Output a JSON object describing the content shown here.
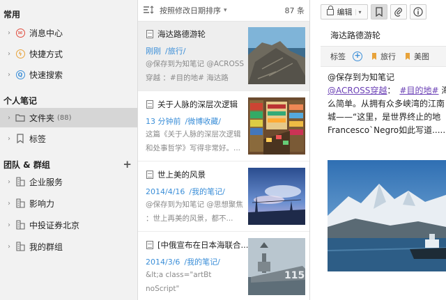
{
  "sidebar": {
    "sections": {
      "common": "常用",
      "personal": "个人笔记",
      "team": "团队 & 群组"
    },
    "common_items": [
      {
        "label": "消息中心",
        "icon": "message-icon",
        "color": "#e04a3c"
      },
      {
        "label": "快捷方式",
        "icon": "lightning-icon",
        "color": "#e8a33a"
      },
      {
        "label": "快速搜索",
        "icon": "search-icon",
        "color": "#3a8ed8"
      }
    ],
    "personal_items": [
      {
        "label": "文件夹",
        "count": "(88)",
        "icon": "folder-icon"
      },
      {
        "label": "标签",
        "icon": "tag-icon"
      }
    ],
    "team_items": [
      {
        "label": "企业服务",
        "icon": "group-icon"
      },
      {
        "label": "影响力",
        "icon": "group-icon"
      },
      {
        "label": "中投证券北京",
        "icon": "group-icon"
      },
      {
        "label": "我的群组",
        "icon": "group-icon"
      }
    ],
    "add_symbol": "+"
  },
  "list": {
    "sort_label": "按照修改日期排序",
    "count": "87 条",
    "notes": [
      {
        "title": "海达路德游轮",
        "date": "刚刚",
        "folder": "/旅行/",
        "snippet": "@保存到为知笔记 @ACROSS穿越 ：#目的地# 海达路",
        "thumb": "cliff-thumbnail"
      },
      {
        "title": "关于人脉的深层次逻辑",
        "date": "13 分钟前",
        "folder": "/微博收藏/",
        "snippet": "这篇《关于人脉的深层次逻辑和处事哲学》写得非常好。...",
        "thumb": "bookstore-thumbnail"
      },
      {
        "title": "世上美的风景",
        "date": "2014/4/16",
        "folder": "/我的笔记/",
        "snippet": "@保存到为知笔记 @思想聚焦 ：世上再美的风景，都不...",
        "thumb": "anime-sky-thumbnail"
      },
      {
        "title": "[中俄宣布在日本海联合...",
        "date": "2014/3/6",
        "folder": "/我的笔记/",
        "snippet": "&lt;a class=\"artBt noScript\" href=\"http://pro.sina.cn/?...",
        "thumb": "warship-thumbnail"
      }
    ]
  },
  "editor": {
    "edit_label": "编辑",
    "title": "海达路德游轮",
    "tag_label": "标签",
    "tags": [
      "旅行",
      "美图"
    ],
    "line1": "@保存到为知笔记",
    "line2_link": "@ACROSS穿越",
    "line2_rest": "：",
    "line2_hash": "#目的地#",
    "line2_tail": " 海",
    "line3": "么简单。从拥有众多峡湾的江南",
    "line4": "城——“这里，是世界终止的地",
    "line5": "Francesco`Negro如此写道......"
  },
  "colors": {
    "accent": "#3a8ed8",
    "link": "#6a3fb5",
    "tag_flag": "#e8a33a"
  }
}
